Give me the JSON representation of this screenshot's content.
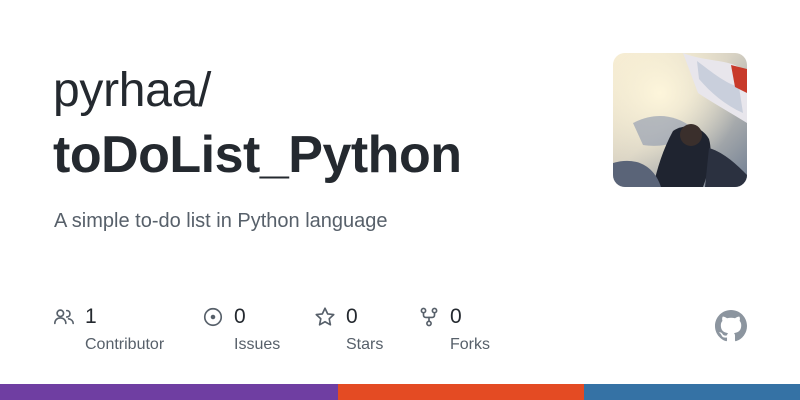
{
  "repo": {
    "owner": "pyrhaa/",
    "name": "toDoList_Python",
    "description": "A simple to-do list in Python language"
  },
  "stats": [
    {
      "icon": "people-icon",
      "value": "1",
      "label": "Contributor"
    },
    {
      "icon": "issue-icon",
      "value": "0",
      "label": "Issues"
    },
    {
      "icon": "star-icon",
      "value": "0",
      "label": "Stars"
    },
    {
      "icon": "fork-icon",
      "value": "0",
      "label": "Forks"
    }
  ],
  "brand": {
    "icon": "github-icon"
  },
  "colors": {
    "text": "#24292f",
    "muted": "#57606a",
    "language_bar": [
      "#6f3ea2",
      "#e44b23",
      "#3572a5"
    ]
  }
}
